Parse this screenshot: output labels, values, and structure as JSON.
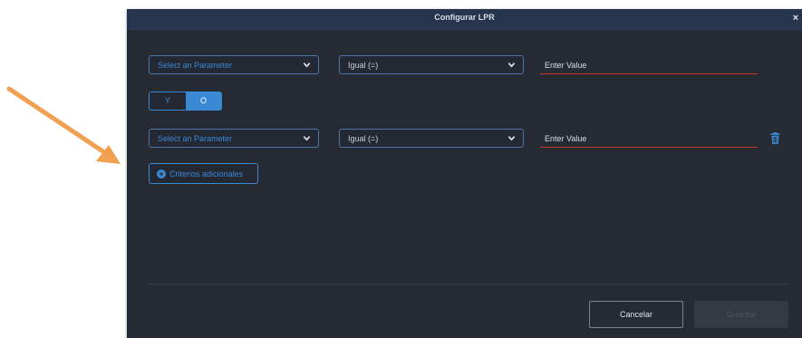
{
  "dialog": {
    "title": "Configurar LPR",
    "close_label": "×"
  },
  "rows": [
    {
      "parameter_placeholder": "Select an Parameter",
      "operator": "Igual (=)",
      "value_placeholder": "Enter Value"
    },
    {
      "parameter_placeholder": "Select an Parameter",
      "operator": "Igual (=)",
      "value_placeholder": "Enter Value"
    }
  ],
  "logic_toggle": {
    "options": [
      "Y",
      "O"
    ],
    "selected": "O"
  },
  "add_criteria_label": "Criterios adicionales",
  "buttons": {
    "cancel": "Cancelar",
    "save": "Guardar"
  },
  "colors": {
    "dialog_bg": "#262a33",
    "titlebar_bg": "#26344e",
    "accent": "#3a89d4",
    "error_underline": "#c0392b",
    "annotation_arrow": "#f0a050"
  },
  "icons": {
    "annotation": "arrow-icon",
    "dropdown": "chevron-down-icon",
    "delete": "trash-icon",
    "add": "plus-circle-icon"
  }
}
